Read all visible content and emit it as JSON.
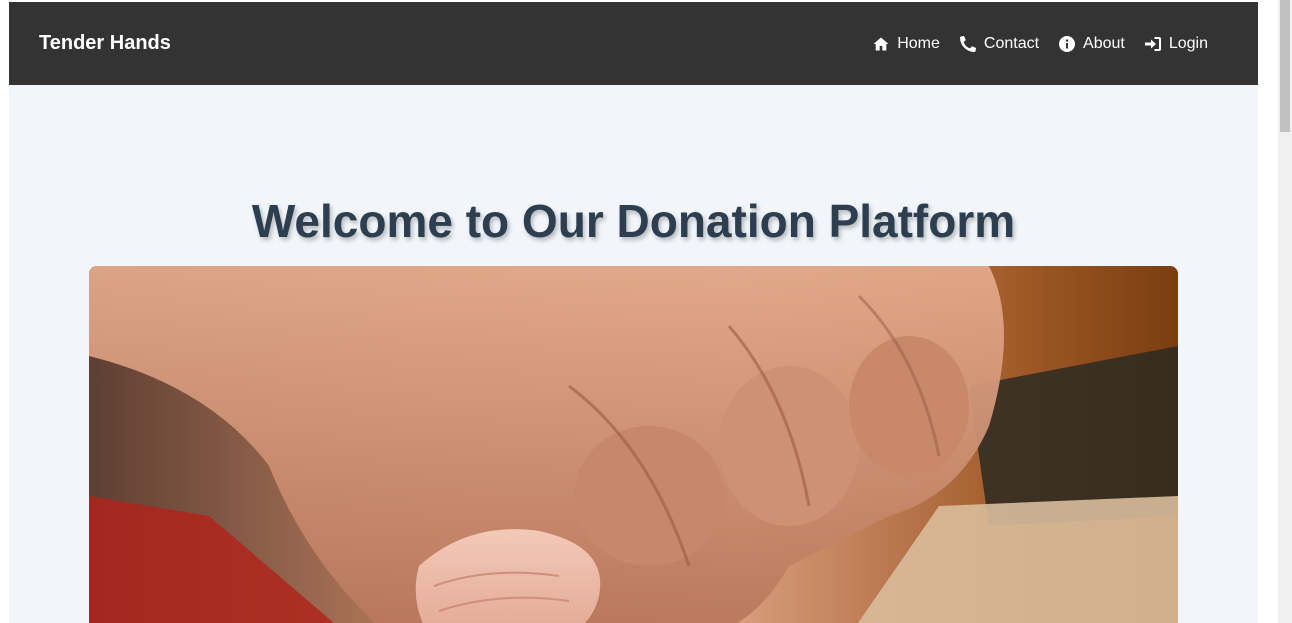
{
  "navbar": {
    "brand": "Tender Hands",
    "links": [
      {
        "label": "Home",
        "icon": "home-icon"
      },
      {
        "label": "Contact",
        "icon": "phone-icon"
      },
      {
        "label": "About",
        "icon": "info-icon"
      },
      {
        "label": "Login",
        "icon": "sign-in-icon"
      }
    ]
  },
  "hero": {
    "title": "Welcome to Our Donation Platform",
    "image_alt": "Adult hand holding a baby's hand"
  },
  "colors": {
    "navbar_bg": "#333333",
    "page_bg": "#f2f6fa",
    "title": "#2c3e50"
  }
}
